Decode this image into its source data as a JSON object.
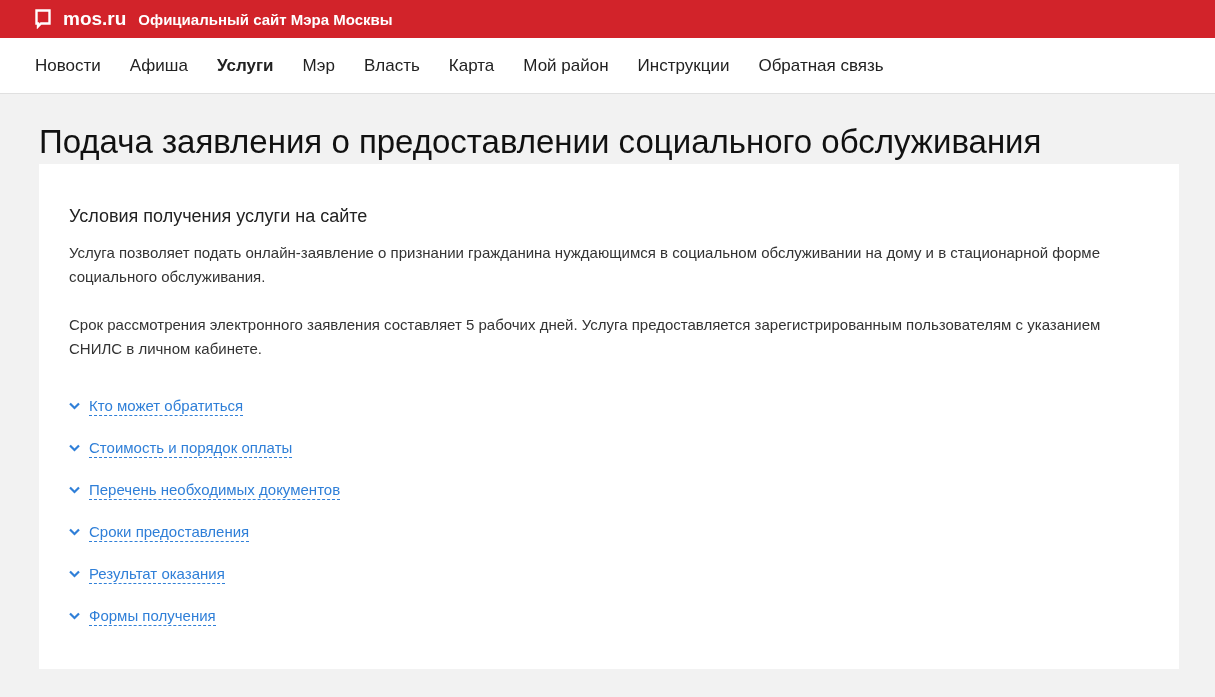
{
  "top_bar": {
    "logo": "mos.ru",
    "tagline": "Официальный сайт Мэра Москвы"
  },
  "nav": [
    {
      "label": "Новости",
      "selected": false
    },
    {
      "label": "Афиша",
      "selected": false
    },
    {
      "label": "Услуги",
      "selected": true
    },
    {
      "label": "Мэр",
      "selected": false
    },
    {
      "label": "Власть",
      "selected": false
    },
    {
      "label": "Карта",
      "selected": false
    },
    {
      "label": "Мой район",
      "selected": false
    },
    {
      "label": "Инструкции",
      "selected": false
    },
    {
      "label": "Обратная связь",
      "selected": false
    }
  ],
  "page_title": "Подача заявления о предоставлении социального обслуживания",
  "card": {
    "heading": "Условия получения услуги на сайте",
    "paragraphs": [
      "Услуга позволяет подать онлайн-заявление о признании гражданина нуждающимся в социальном обслуживании на дому и в стационарной форме социального обслуживания.",
      "Срок рассмотрения электронного заявления составляет 5 рабочих дней. Услуга предоставляется зарегистрированным пользователям с указанием СНИЛС в личном кабинете."
    ],
    "sections": [
      {
        "label": "Кто может обратиться",
        "expanded": false
      },
      {
        "label": "Стоимость и порядок оплаты",
        "expanded": false
      },
      {
        "label": "Перечень необходимых документов",
        "expanded": false
      },
      {
        "label": "Сроки предоставления",
        "expanded": false
      },
      {
        "label": "Результат оказания",
        "expanded": false
      },
      {
        "label": "Формы получения",
        "expanded": false
      }
    ]
  }
}
